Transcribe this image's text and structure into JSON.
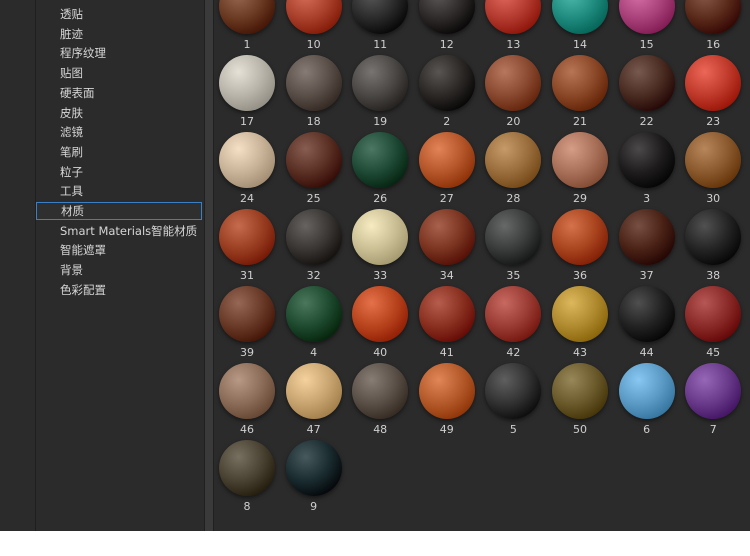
{
  "sidebar": {
    "selected_index": 10,
    "items": [
      {
        "label": "透贴"
      },
      {
        "label": "脏迹"
      },
      {
        "label": "程序纹理"
      },
      {
        "label": "贴图"
      },
      {
        "label": "硬表面"
      },
      {
        "label": "皮肤"
      },
      {
        "label": "滤镜"
      },
      {
        "label": "笔刷"
      },
      {
        "label": "粒子"
      },
      {
        "label": "工具"
      },
      {
        "label": "材质"
      },
      {
        "label": "Smart Materials智能材质"
      },
      {
        "label": "智能遮罩"
      },
      {
        "label": "背景"
      },
      {
        "label": "色彩配置"
      }
    ]
  },
  "materials": [
    {
      "label": "1",
      "color": "#6a3a22"
    },
    {
      "label": "10",
      "color": "#a8402c"
    },
    {
      "label": "11",
      "color": "#2a2a2a"
    },
    {
      "label": "12",
      "color": "#2e2a29"
    },
    {
      "label": "13",
      "color": "#b23a2e"
    },
    {
      "label": "14",
      "color": "#1f8a7e"
    },
    {
      "label": "15",
      "color": "#a8407a"
    },
    {
      "label": "16",
      "color": "#5a2a1a"
    },
    {
      "label": "17",
      "color": "#b8b4aa"
    },
    {
      "label": "18",
      "color": "#5a4f48"
    },
    {
      "label": "19",
      "color": "#4a4744"
    },
    {
      "label": "2",
      "color": "#2c2826"
    },
    {
      "label": "20",
      "color": "#8a4a32"
    },
    {
      "label": "21",
      "color": "#8a4828"
    },
    {
      "label": "22",
      "color": "#4a2c22"
    },
    {
      "label": "23",
      "color": "#c03a2c"
    },
    {
      "label": "24",
      "color": "#c8b298"
    },
    {
      "label": "25",
      "color": "#5a3024"
    },
    {
      "label": "26",
      "color": "#1e4a36"
    },
    {
      "label": "27",
      "color": "#b4562a"
    },
    {
      "label": "28",
      "color": "#9a6e3c"
    },
    {
      "label": "29",
      "color": "#a87058"
    },
    {
      "label": "3",
      "color": "#1e1c1c"
    },
    {
      "label": "30",
      "color": "#8a5a2e"
    },
    {
      "label": "31",
      "color": "#9a3e22"
    },
    {
      "label": "32",
      "color": "#3a3634"
    },
    {
      "label": "33",
      "color": "#cabf94"
    },
    {
      "label": "34",
      "color": "#7a3420"
    },
    {
      "label": "35",
      "color": "#3a3c3c"
    },
    {
      "label": "36",
      "color": "#a8441e"
    },
    {
      "label": "37",
      "color": "#4a2216"
    },
    {
      "label": "38",
      "color": "#242424"
    },
    {
      "label": "39",
      "color": "#6a3a28"
    },
    {
      "label": "4",
      "color": "#1e4a30"
    },
    {
      "label": "40",
      "color": "#b8441e"
    },
    {
      "label": "41",
      "color": "#8a3020"
    },
    {
      "label": "42",
      "color": "#9a3c34"
    },
    {
      "label": "43",
      "color": "#b08a2e"
    },
    {
      "label": "44",
      "color": "#222222"
    },
    {
      "label": "45",
      "color": "#8a2a28"
    },
    {
      "label": "46",
      "color": "#8a6c58"
    },
    {
      "label": "47",
      "color": "#c8a470"
    },
    {
      "label": "48",
      "color": "#5a5048"
    },
    {
      "label": "49",
      "color": "#b45a2a"
    },
    {
      "label": "5",
      "color": "#323232"
    },
    {
      "label": "50",
      "color": "#6a5a2c"
    },
    {
      "label": "6",
      "color": "#5a9ac4"
    },
    {
      "label": "7",
      "color": "#6a3a8a"
    },
    {
      "label": "8",
      "color": "#4a4232"
    },
    {
      "label": "9",
      "color": "#1a2c30"
    }
  ]
}
